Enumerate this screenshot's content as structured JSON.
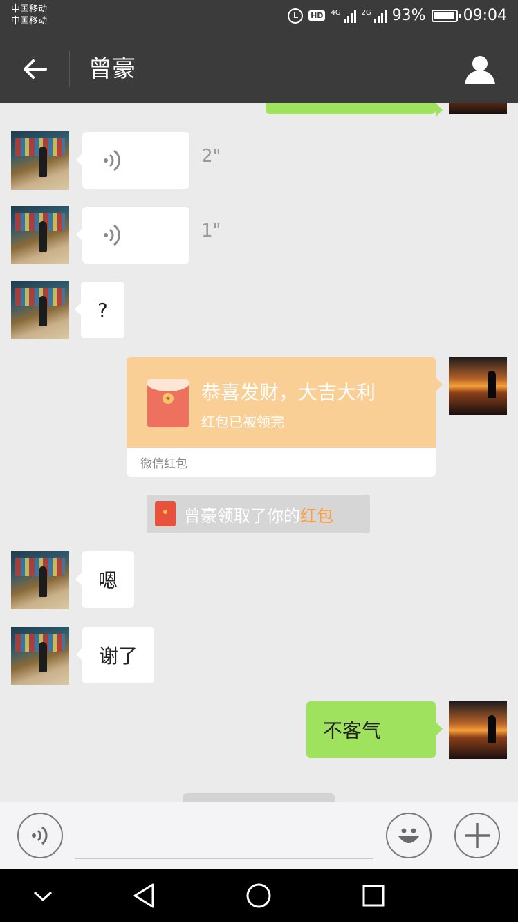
{
  "status_bar": {
    "carrier_1": "中国移动",
    "carrier_2": "中国移动",
    "hd_label": "HD",
    "sim1_tag": "4G",
    "sim2_tag": "2G",
    "battery": "93%",
    "time": "09:04"
  },
  "header": {
    "title": "曾豪",
    "back_icon": "arrow-left-icon",
    "profile_icon": "person-icon"
  },
  "messages": [
    {
      "side": "left",
      "type": "voice",
      "duration": "2\""
    },
    {
      "side": "left",
      "type": "voice",
      "duration": "1\""
    },
    {
      "side": "left",
      "type": "text",
      "text": "?"
    },
    {
      "side": "right",
      "type": "red_packet",
      "greeting": "恭喜发财，大吉大利",
      "status": "红包已被领完",
      "label": "微信红包"
    },
    {
      "side": "system",
      "type": "notice",
      "text": "曾豪领取了你的",
      "link": "红包"
    },
    {
      "side": "left",
      "type": "text",
      "text": "嗯"
    },
    {
      "side": "left",
      "type": "text",
      "text": "谢了"
    },
    {
      "side": "right",
      "type": "text",
      "text": "不客气"
    }
  ],
  "input_bar": {
    "value": "",
    "voice_icon": "voice-input-icon",
    "emoji_icon": "emoji-icon",
    "plus_icon": "plus-icon"
  },
  "nav_bar": {
    "icons": [
      "chevron-down-icon",
      "back-triangle-icon",
      "home-circle-icon",
      "recents-square-icon"
    ]
  },
  "colors": {
    "bar_bg": "#3b3b3b",
    "chat_bg": "#ebebeb",
    "sent_bubble": "#9fe25e",
    "red_packet": "#f9cf96",
    "link_orange": "#fa9d3b"
  }
}
